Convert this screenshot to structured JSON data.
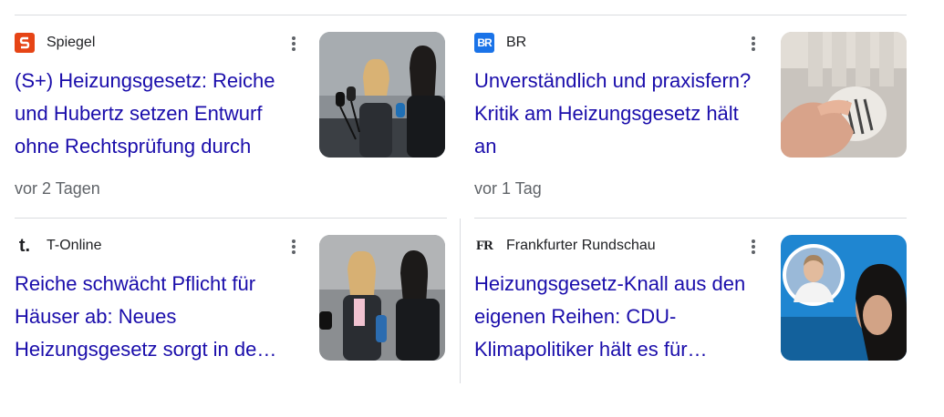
{
  "cards": [
    {
      "source": "Spiegel",
      "logo_letter": "S",
      "logo_color": "#e64415",
      "title": "(S+) Heizungsgesetz: Reiche und Hubertz setzen Entwurf ohne Rechtsprüfung durch",
      "date": "vor 2 Tagen",
      "image": "photo-two-women-at-microphones"
    },
    {
      "source": "BR",
      "logo_letter": "BR",
      "logo_color": "#1a73e8",
      "title": "Unverständlich und praxisfern? Kritik am Heizungsgesetz hält an",
      "date": "vor 1 Tag",
      "image": "photo-hand-on-radiator-thermostat"
    },
    {
      "source": "T-Online",
      "logo_letter": "t.",
      "logo_color": "#202124",
      "title": "Reiche schwächt Pflicht für Häuser ab: Neues Heizungsgesetz sorgt in de…",
      "date": "",
      "image": "photo-two-women-press-conference"
    },
    {
      "source": "Frankfurter Rundschau",
      "logo_letter": "FR",
      "logo_color": "#202124",
      "title": "Heizungsgesetz-Knall aus den eigenen Reihen: CDU-Klimapolitiker hält es für…",
      "date": "",
      "image": "photo-portrait-man-and-woman"
    }
  ]
}
